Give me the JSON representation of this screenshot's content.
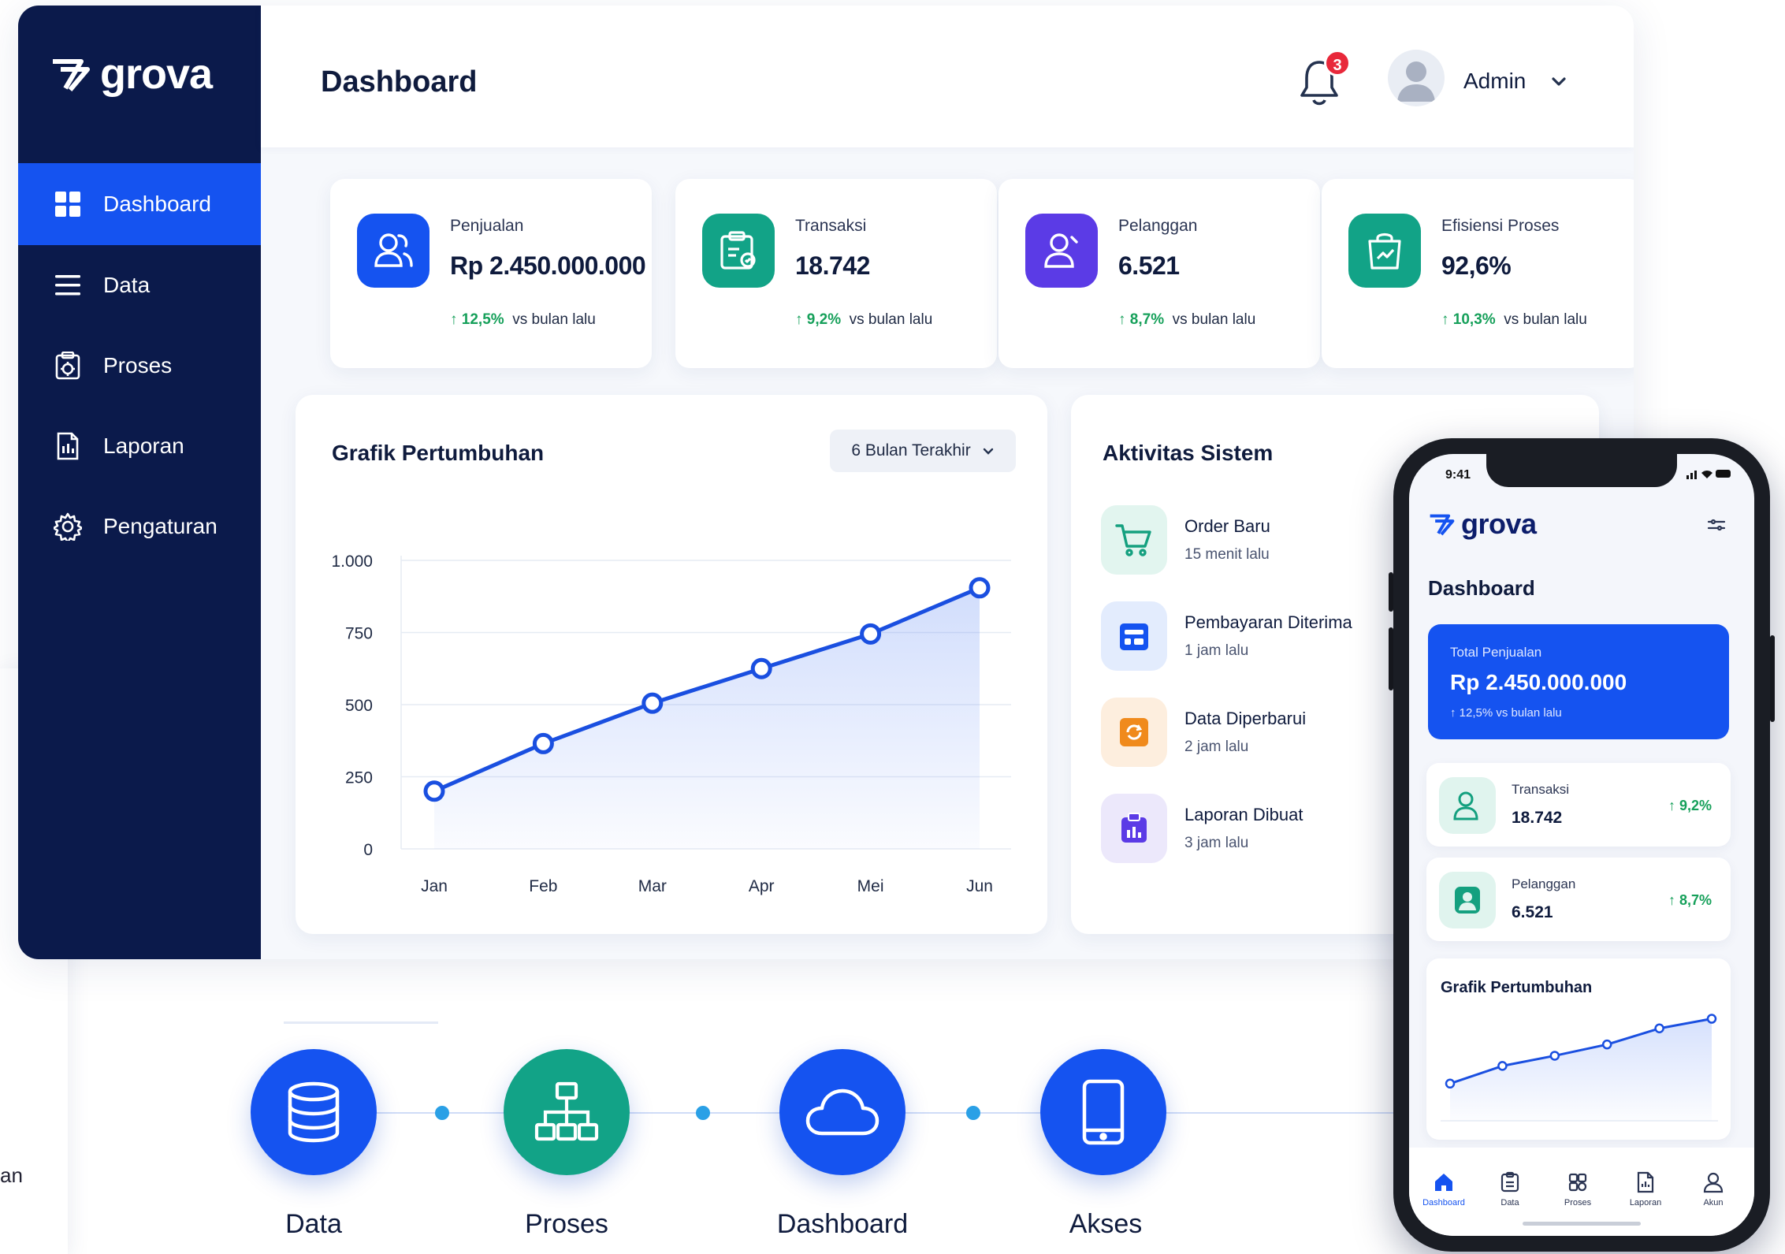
{
  "brand": {
    "name": "grova"
  },
  "sidebar": {
    "items": [
      {
        "label": "Dashboard",
        "icon": "grid-icon",
        "active": true
      },
      {
        "label": "Data",
        "icon": "list-icon"
      },
      {
        "label": "Proses",
        "icon": "process-icon"
      },
      {
        "label": "Laporan",
        "icon": "report-icon"
      },
      {
        "label": "Pengaturan",
        "icon": "gear-icon"
      }
    ]
  },
  "header": {
    "title": "Dashboard",
    "notification_count": "3",
    "user_name": "Admin"
  },
  "stats": [
    {
      "label": "Penjualan",
      "value": "Rp 2.450.000.000",
      "change": "↑ 12,5%",
      "note": "vs bulan lalu",
      "icon": "users-icon",
      "color": "#1553f0"
    },
    {
      "label": "Transaksi",
      "value": "18.742",
      "change": "↑ 9,2%",
      "note": "vs bulan lalu",
      "icon": "clipboard-icon",
      "color": "#12a387"
    },
    {
      "label": "Pelanggan",
      "value": "6.521",
      "change": "↑ 8,7%",
      "note": "vs bulan lalu",
      "icon": "user-icon",
      "color": "#5b3be6"
    },
    {
      "label": "Efisiensi Proses",
      "value": "92,6%",
      "change": "↑ 10,3%",
      "note": "vs bulan lalu",
      "icon": "bag-icon",
      "color": "#12a387"
    }
  ],
  "growth_chart": {
    "title": "Grafik Pertumbuhan",
    "range_label": "6 Bulan Terakhir"
  },
  "chart_data": [
    {
      "type": "area",
      "title": "Grafik Pertumbuhan",
      "categories": [
        "Jan",
        "Feb",
        "Mar",
        "Apr",
        "Mei",
        "Jun"
      ],
      "values": [
        200,
        365,
        505,
        625,
        745,
        905
      ],
      "y_ticks": [
        "1.000",
        "750",
        "500",
        "250",
        "0"
      ],
      "ylim": [
        0,
        1000
      ],
      "grid": true,
      "color": "#1a4fe0"
    },
    {
      "type": "area",
      "title": "Grafik Pertumbuhan",
      "values": [
        200,
        365,
        460,
        565,
        715,
        805
      ],
      "color": "#1a4fe0"
    }
  ],
  "activity": {
    "title": "Aktivitas Sistem",
    "items": [
      {
        "name": "Order Baru",
        "time": "15 menit lalu",
        "icon": "cart-icon",
        "bg": "#e2f5ef",
        "fg": "#14a07f"
      },
      {
        "name": "Pembayaran Diterima",
        "time": "1 jam lalu",
        "icon": "payment-icon",
        "bg": "#e3ecfd",
        "fg": "#1553f0"
      },
      {
        "name": "Data Diperbarui",
        "time": "2 jam lalu",
        "icon": "refresh-icon",
        "bg": "#fdeede",
        "fg": "#f08a1c"
      },
      {
        "name": "Laporan Dibuat",
        "time": "3 jam lalu",
        "icon": "report-icon",
        "bg": "#ece8fb",
        "fg": "#5b3be6"
      }
    ]
  },
  "flow": [
    {
      "label": "Data",
      "icon": "database-icon",
      "color": "#1553f0"
    },
    {
      "label": "Proses",
      "icon": "hierarchy-icon",
      "color": "#12a387"
    },
    {
      "label": "Dashboard",
      "icon": "cloud-icon",
      "color": "#1553f0"
    },
    {
      "label": "Akses",
      "icon": "mobile-icon",
      "color": "#1553f0"
    }
  ],
  "left_edge": {
    "text": "an"
  },
  "mobile": {
    "time": "9:41",
    "brand": "grova",
    "title": "Dashboard",
    "hero": {
      "label": "Total Penjualan",
      "value": "Rp 2.450.000.000",
      "trend": "↑ 12,5%  vs bulan lalu"
    },
    "cards": [
      {
        "label": "Transaksi",
        "value": "18.742",
        "trend": "↑ 9,2%",
        "icon": "clipboard-user-icon"
      },
      {
        "label": "Pelanggan",
        "value": "6.521",
        "trend": "↑ 8,7%",
        "icon": "user-badge-icon"
      }
    ],
    "chart_title": "Grafik Pertumbuhan",
    "tabs": [
      {
        "label": "Dashboard",
        "icon": "home-icon",
        "active": true
      },
      {
        "label": "Data",
        "icon": "data-icon"
      },
      {
        "label": "Proses",
        "icon": "process-icon"
      },
      {
        "label": "Laporan",
        "icon": "report-icon"
      },
      {
        "label": "Akun",
        "icon": "account-icon"
      }
    ]
  }
}
